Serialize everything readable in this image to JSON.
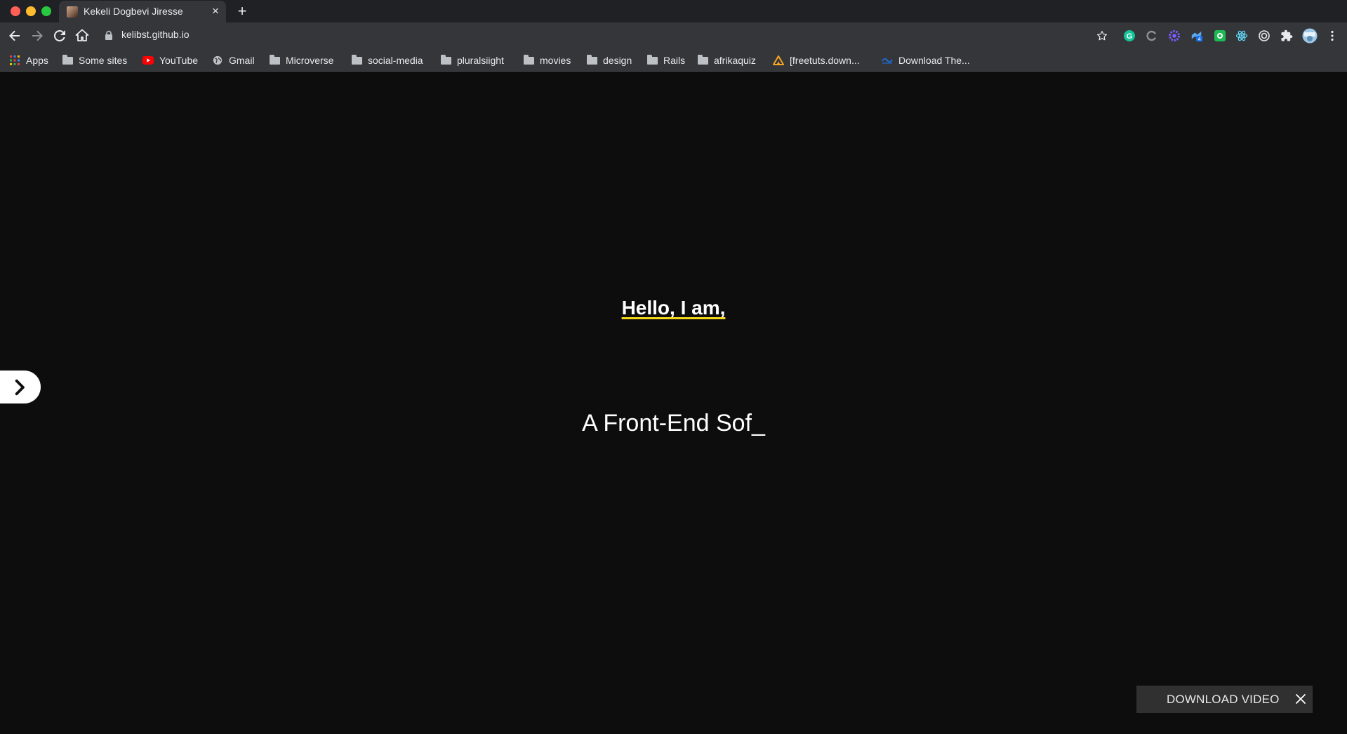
{
  "browser": {
    "tab_title": "Kekeli Dogbevi Jiresse",
    "tab_close": "×",
    "new_tab": "+",
    "url": "kelibst.github.io",
    "bookmarks": [
      {
        "label": "Apps",
        "icon": "apps-grid-icon"
      },
      {
        "label": "Some sites",
        "icon": "folder-icon"
      },
      {
        "label": "YouTube",
        "icon": "youtube-icon"
      },
      {
        "label": "Gmail",
        "icon": "globe-icon"
      },
      {
        "label": "Microverse",
        "icon": "folder-icon"
      },
      {
        "label": "social-media",
        "icon": "folder-icon"
      },
      {
        "label": "pluralsiight",
        "icon": "folder-icon"
      },
      {
        "label": "movies",
        "icon": "folder-icon"
      },
      {
        "label": "design",
        "icon": "folder-icon"
      },
      {
        "label": "Rails",
        "icon": "folder-icon"
      },
      {
        "label": "afrikaquiz",
        "icon": "folder-icon"
      },
      {
        "label": "[freetuts.down...",
        "icon": "freetuts-icon"
      },
      {
        "label": "Download The...",
        "icon": "download-site-icon"
      }
    ],
    "extensions": [
      "grammarly-icon",
      "extension-c-icon",
      "gear-purple-icon",
      "extension-badge-icon",
      "screen-capture-icon",
      "react-devtools-icon",
      "target-icon",
      "puzzle-icon",
      "profile-avatar-icon"
    ],
    "extension_badge": "4",
    "colors": {
      "chrome_dark": "#202124",
      "chrome": "#35363a",
      "text": "#e8eaed"
    }
  },
  "page": {
    "greeting": "Hello, I am,",
    "role_typing": "A Front-End Sof_",
    "download_label": "DOWNLOAD VIDEO",
    "download_close": "✕",
    "colors": {
      "background": "#0d0d0d",
      "underline": "#f5d71a",
      "text": "#ffffff"
    }
  }
}
